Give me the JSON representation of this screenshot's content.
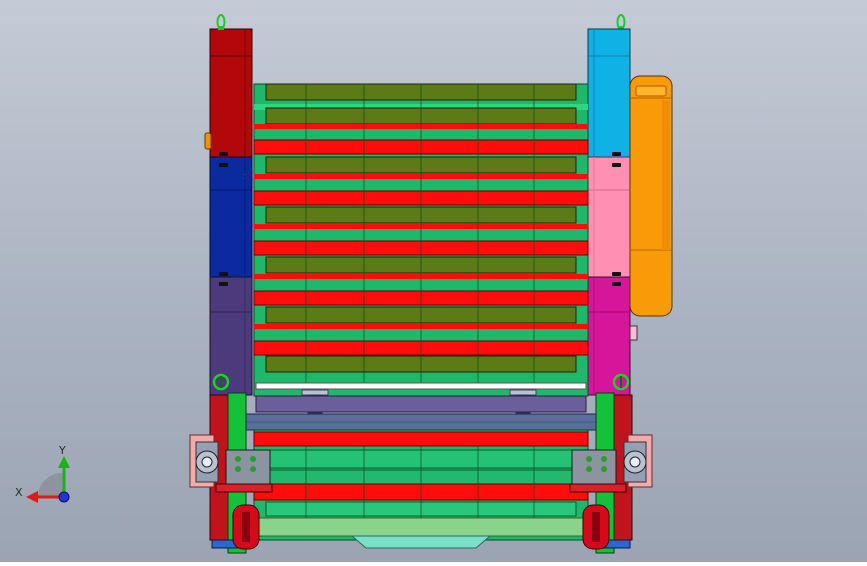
{
  "viewport": {
    "background_top": "#c4cbd6",
    "background_bottom": "#9ba4b3"
  },
  "model": {
    "colors": {
      "left_upper": "#b3080b",
      "left_middle": "#0b2aa0",
      "left_lower": "#4b3a7c",
      "right_upper": "#0fb2e4",
      "right_middle": "#ff8fb3",
      "right_lower": "#d6169a",
      "motor": "#f99a08",
      "roller_band": "#1fb86b",
      "red_band": "#ff0d0d",
      "olive_plate": "#5c7a16",
      "crossbar": "#5a6e9c",
      "frame_green": "#14c23a",
      "frame_red": "#c0141c",
      "base_plate": "#7ae0c8"
    },
    "icons": [
      "lifting-eye-icon",
      "lifting-eye-icon",
      "hinge-icon",
      "hinge-icon",
      "wheel-icon",
      "wheel-icon"
    ]
  },
  "triad": {
    "x_label": "X",
    "y_label": "Y",
    "x_color": "#e0191e",
    "y_color": "#19b319",
    "z_color": "#2136d9"
  }
}
